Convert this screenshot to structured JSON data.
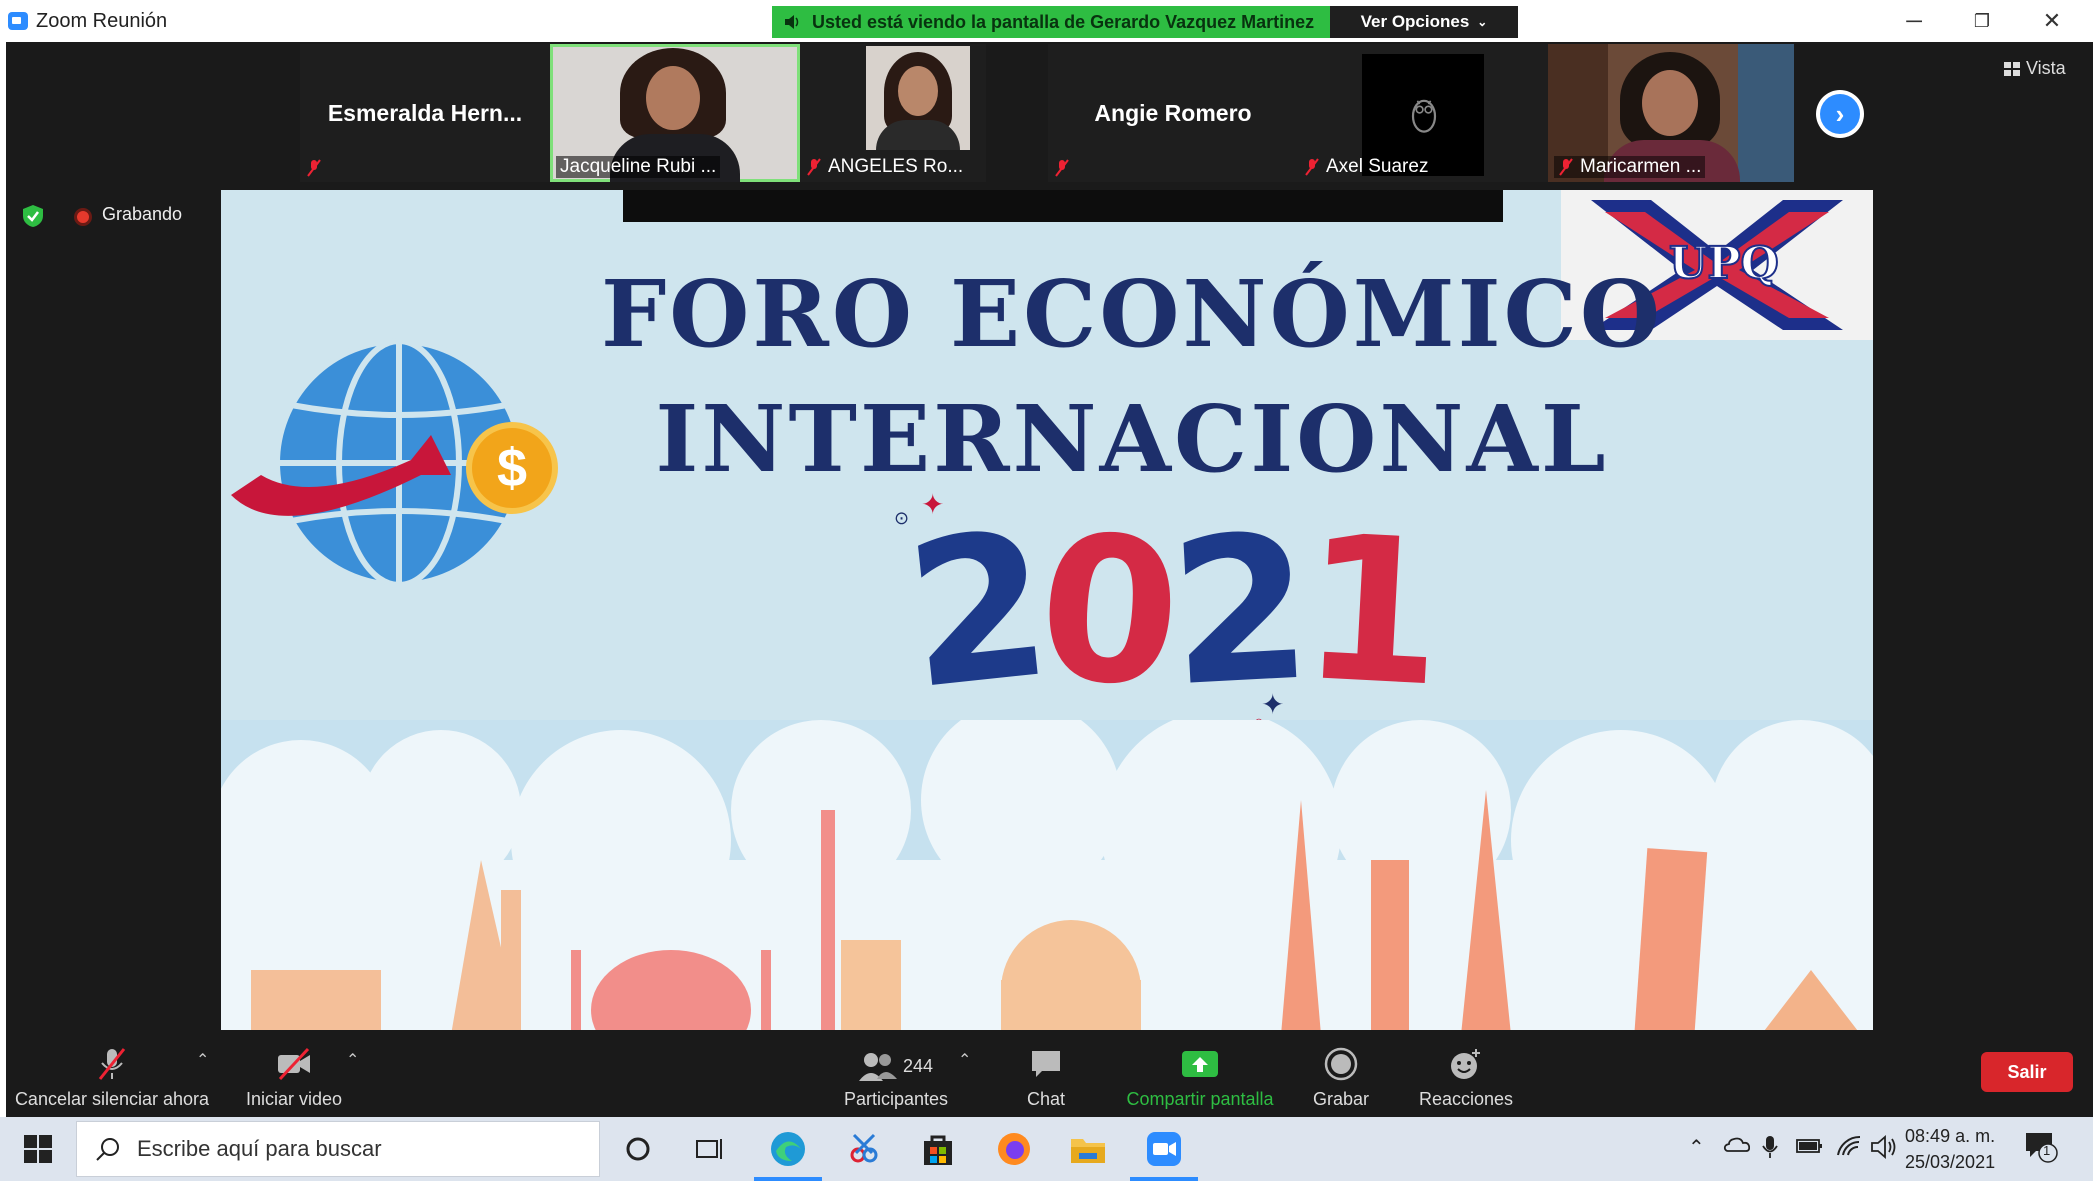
{
  "window": {
    "title": "Zoom Reunión",
    "share_banner": "Usted está viendo la pantalla de Gerardo Vazquez Martinez",
    "view_options": "Ver Opciones",
    "minimize": "─",
    "restore": "❐",
    "close": "✕"
  },
  "participants_strip": [
    {
      "name": "Esmeralda  Hern...",
      "label": ""
    },
    {
      "name": "",
      "label": "Jacqueline Rubi ..."
    },
    {
      "name": "",
      "label": "ANGELES Ro..."
    },
    {
      "name": "Angie Romero",
      "label": ""
    },
    {
      "name": "",
      "label": "Axel Suarez"
    },
    {
      "name": "",
      "label": "Maricarmen ..."
    }
  ],
  "view": {
    "label": "Vista"
  },
  "recording": {
    "label": "Grabando"
  },
  "slide": {
    "line1": "FORO ECONÓMICO",
    "line2": "INTERNACIONAL",
    "year_digits": [
      "2",
      "0",
      "2",
      "1"
    ],
    "logo_text": "UPQ",
    "coin_symbol": "$"
  },
  "toolbar": {
    "unmute": "Cancelar silenciar ahora",
    "video": "Iniciar video",
    "participants": "Participantes",
    "participants_count": "244",
    "chat": "Chat",
    "share": "Compartir pantalla",
    "record": "Grabar",
    "reactions": "Reacciones",
    "leave": "Salir"
  },
  "taskbar": {
    "search_placeholder": "Escribe aquí para buscar",
    "time": "08:49 a. m.",
    "date": "25/03/2021",
    "notification_count": "1"
  },
  "colors": {
    "accent": "#2D8CFF",
    "share_green": "#2EBD42",
    "leave_red": "#D8262B",
    "title_navy": "#1D2F6B",
    "year_red": "#D42A45"
  }
}
